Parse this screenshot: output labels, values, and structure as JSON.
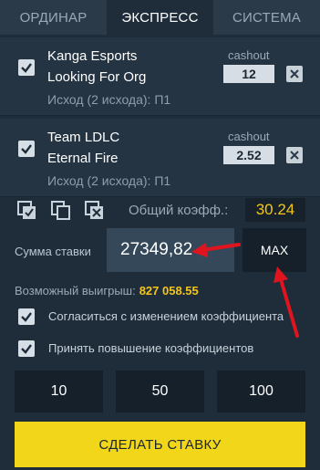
{
  "tabs": [
    "ОРДИНАР",
    "ЭКСПРЕСС",
    "СИСТЕМА"
  ],
  "active_tab": "ЭКСПРЕСС",
  "bets": [
    {
      "team1": "Kanga Esports",
      "team2": "Looking For Org",
      "outcome": "Исход (2 исхода): П1",
      "cashout_label": "cashout",
      "coefficient": "12",
      "checked": true
    },
    {
      "team1": "Team LDLC",
      "team2": "Eternal Fire",
      "outcome": "Исход (2 исхода): П1",
      "cashout_label": "cashout",
      "coefficient": "2.52",
      "checked": true
    }
  ],
  "total": {
    "label": "Общий коэфф.:",
    "value": "30.24"
  },
  "stake": {
    "label": "Сумма ставки",
    "value": "27349,82",
    "max_label": "MAX"
  },
  "winnings": {
    "label": "Возможный выигрыш:",
    "value": "827 058.55"
  },
  "options": [
    {
      "label": "Согласиться с изменением коэффициента",
      "checked": true
    },
    {
      "label": "Принять повышение коэффициентов",
      "checked": true
    }
  ],
  "quick_amounts": [
    "10",
    "50",
    "100"
  ],
  "place_bet_label": "СДЕЛАТЬ СТАВКУ",
  "colors": {
    "accent": "#f2d619",
    "highlight_text": "#f5c518",
    "annotation": "#e0141e",
    "background": "#1f2d3b"
  }
}
